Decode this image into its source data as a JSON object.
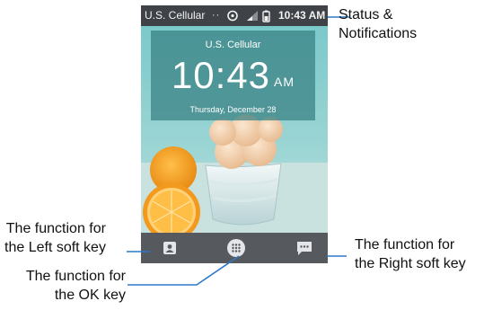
{
  "status_bar": {
    "carrier": "U.S. Cellular",
    "more_indicator": "··",
    "time": "10:43 AM",
    "icons": [
      "sync-icon",
      "signal-icon",
      "battery-icon"
    ]
  },
  "clock_widget": {
    "carrier": "U.S. Cellular",
    "time": "10:43",
    "ampm": "AM",
    "date": "Thursday, December 28"
  },
  "soft_keys": {
    "left_icon": "contacts-icon",
    "ok_icon": "apps-grid-icon",
    "right_icon": "messages-icon"
  },
  "callouts": {
    "status": [
      "Status &",
      "Notifications"
    ],
    "left": [
      "The function for",
      "the Left soft key"
    ],
    "ok": [
      "The function for",
      "the OK key"
    ],
    "right": [
      "The function for",
      "the Right soft key"
    ]
  },
  "colors": {
    "status_bar": "#3f4247",
    "clock_panel": "#378082",
    "soft_bar": "#56595e",
    "leader_line": "#2f78c8"
  }
}
